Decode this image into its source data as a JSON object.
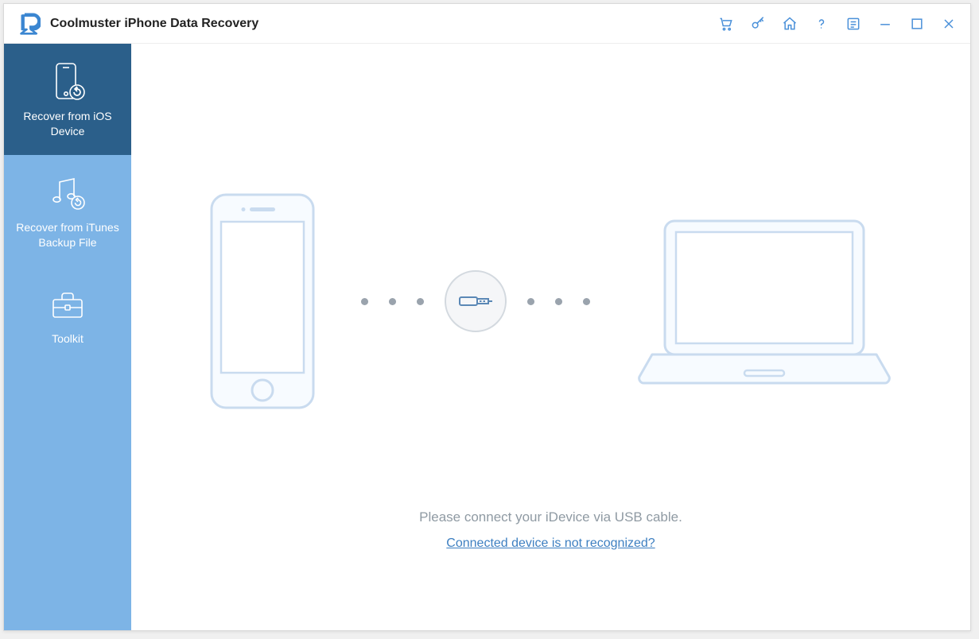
{
  "titlebar": {
    "title": "Coolmuster iPhone Data Recovery",
    "icons": {
      "cart": "cart-icon",
      "key": "key-icon",
      "home": "home-icon",
      "help": "help-icon",
      "feedback": "feedback-icon",
      "minimize": "minimize-icon",
      "maximize": "maximize-icon",
      "close": "close-icon"
    }
  },
  "sidebar": {
    "items": [
      {
        "id": "recover-ios",
        "label": "Recover from iOS Device",
        "active": true
      },
      {
        "id": "recover-itunes",
        "label": "Recover from iTunes Backup File",
        "active": false
      },
      {
        "id": "toolkit",
        "label": "Toolkit",
        "active": false
      }
    ]
  },
  "main": {
    "instruction": "Please connect your iDevice via USB cable.",
    "help_link": "Connected device is not recognized?"
  },
  "colors": {
    "accent": "#4a90d9",
    "sidebar_bg": "#7db4e6",
    "sidebar_active": "#2b5f8a",
    "outline": "#c9dbef",
    "muted_text": "#8f9aa3"
  }
}
